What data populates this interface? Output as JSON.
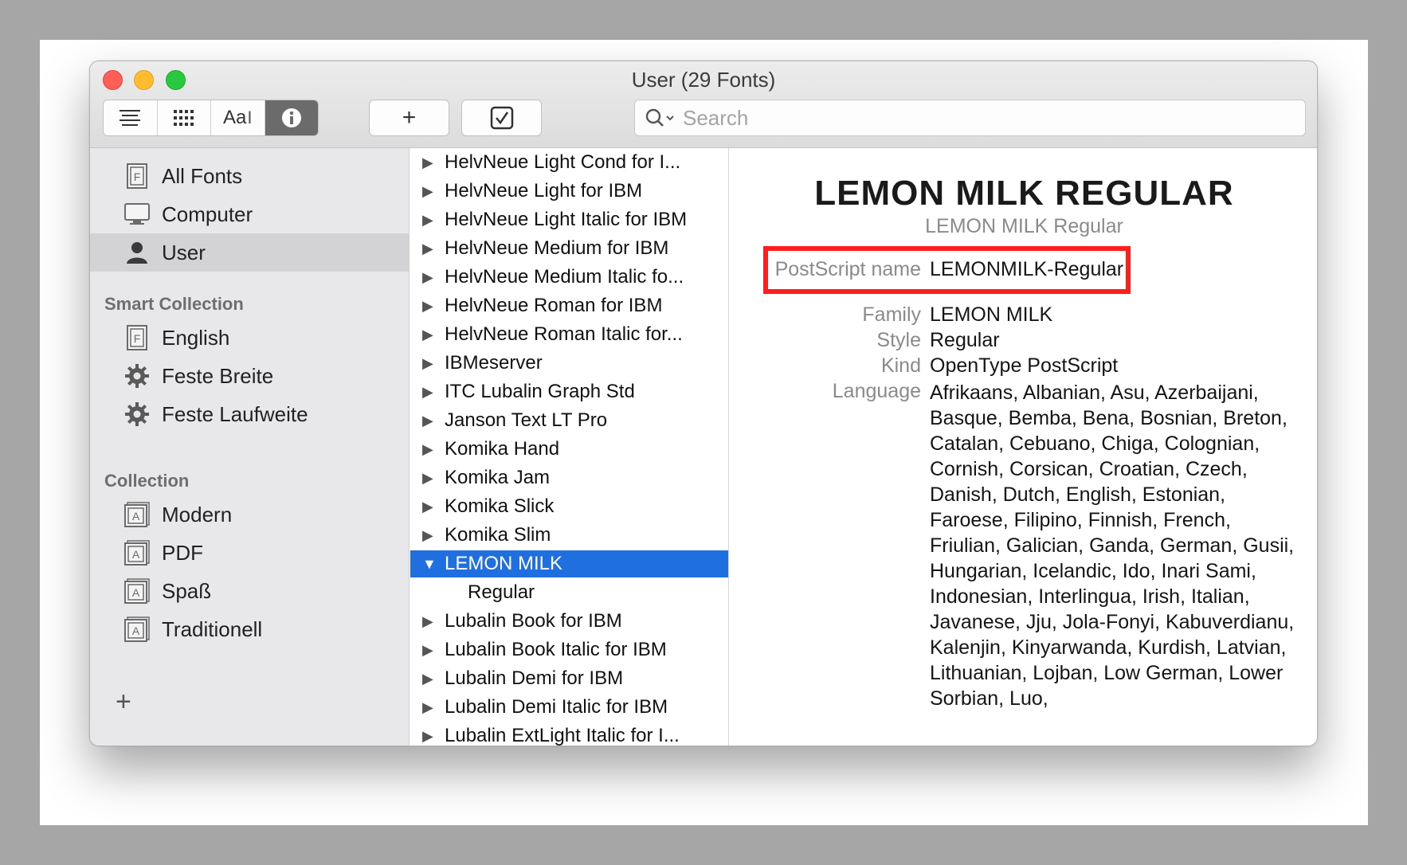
{
  "window": {
    "title": "User (29 Fonts)"
  },
  "toolbar": {
    "view_list_icon": "list-lines-icon",
    "view_grid_icon": "grid-icon",
    "view_sample_label": "Aa",
    "view_info_icon": "info-icon",
    "add_label": "+",
    "search_placeholder": "Search"
  },
  "sidebar": {
    "library_items": [
      {
        "label": "All Fonts",
        "icon": "font-document-icon"
      },
      {
        "label": "Computer",
        "icon": "monitor-icon"
      },
      {
        "label": "User",
        "icon": "person-icon",
        "selected": true
      }
    ],
    "smart_heading": "Smart Collection",
    "smart_items": [
      {
        "label": "English",
        "icon": "font-document-icon"
      },
      {
        "label": "Feste Breite",
        "icon": "gear-icon"
      },
      {
        "label": "Feste Laufweite",
        "icon": "gear-icon"
      }
    ],
    "collection_heading": "Collection",
    "collection_items": [
      {
        "label": "Modern",
        "icon": "collection-icon"
      },
      {
        "label": "PDF",
        "icon": "collection-icon"
      },
      {
        "label": "Spaß",
        "icon": "collection-icon"
      },
      {
        "label": "Traditionell",
        "icon": "collection-icon"
      }
    ],
    "add_label": "+"
  },
  "fontlist": {
    "rows": [
      {
        "label": "HelvNeue Light Cond for I...",
        "expanded": false
      },
      {
        "label": "HelvNeue Light for IBM",
        "expanded": false
      },
      {
        "label": "HelvNeue Light Italic for IBM",
        "expanded": false
      },
      {
        "label": "HelvNeue Medium for IBM",
        "expanded": false
      },
      {
        "label": "HelvNeue Medium Italic fo...",
        "expanded": false
      },
      {
        "label": "HelvNeue Roman for IBM",
        "expanded": false
      },
      {
        "label": "HelvNeue Roman Italic for...",
        "expanded": false
      },
      {
        "label": "IBMeserver",
        "expanded": false
      },
      {
        "label": "ITC Lubalin Graph Std",
        "expanded": false
      },
      {
        "label": "Janson Text LT Pro",
        "expanded": false
      },
      {
        "label": "Komika Hand",
        "expanded": false
      },
      {
        "label": "Komika Jam",
        "expanded": false
      },
      {
        "label": "Komika Slick",
        "expanded": false
      },
      {
        "label": "Komika Slim",
        "expanded": false
      },
      {
        "label": "LEMON MILK",
        "expanded": true,
        "selected": true
      },
      {
        "label": "Regular",
        "child": true
      },
      {
        "label": "Lubalin Book for IBM",
        "expanded": false
      },
      {
        "label": "Lubalin Book Italic for IBM",
        "expanded": false
      },
      {
        "label": "Lubalin Demi for IBM",
        "expanded": false
      },
      {
        "label": "Lubalin Demi Italic for IBM",
        "expanded": false
      },
      {
        "label": "Lubalin ExtLight Italic for I...",
        "expanded": false
      }
    ]
  },
  "info": {
    "title": "LEMON MILK REGULAR",
    "subtitle": "LEMON MILK Regular",
    "postscript_key": "PostScript name",
    "postscript_val": "LEMONMILK-Regular",
    "family_key": "Family",
    "family_val": "LEMON MILK",
    "style_key": "Style",
    "style_val": "Regular",
    "kind_key": "Kind",
    "kind_val": "OpenType PostScript",
    "language_key": "Language",
    "language_val": "Afrikaans, Albanian, Asu, Azerbaijani, Basque, Bemba, Bena, Bosnian, Breton, Catalan, Cebuano, Chiga, Colognian, Cornish, Corsican, Croatian, Czech, Danish, Dutch, English, Estonian, Faroese, Filipino, Finnish, French, Friulian, Galician, Ganda, German, Gusii, Hungarian, Icelandic, Ido, Inari Sami, Indonesian, Interlingua, Irish, Italian, Javanese, Jju, Jola-Fonyi, Kabuverdianu, Kalenjin, Kinyarwanda, Kurdish, Latvian, Lithuanian, Lojban, Low German, Lower Sorbian, Luo,",
    "highlight_color": "#ff1e1e"
  },
  "colors": {
    "selection": "#1f6fe0",
    "sidebar_bg": "#e8e8ea"
  }
}
